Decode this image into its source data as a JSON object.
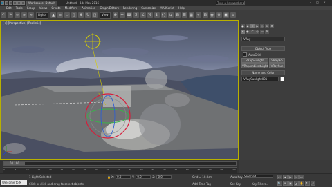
{
  "titlebar": {
    "workspace": "Workspace: Default",
    "file_title": "Untitled - 3ds Max 2016",
    "search_placeholder": "Type a keyword or phrase"
  },
  "menubar": {
    "items": [
      "Edit",
      "Tools",
      "Group",
      "Views",
      "Create",
      "Modifiers",
      "Animation",
      "Graph Editors",
      "Rendering",
      "Customize",
      "MAXScript",
      "Help"
    ]
  },
  "toolbar": {
    "selection_filter": "Lights",
    "reference_coord": "View"
  },
  "viewport": {
    "label": "[+] [Perspective] [Realistic]"
  },
  "command_panel": {
    "category": "VRay",
    "object_type_header": "Object Type",
    "autogrid_label": "AutoGrid",
    "buttons": [
      "VRaySunlight",
      "VRayIES",
      "VRayAmbientLight",
      "VRaySun"
    ],
    "name_color_header": "Name and Color",
    "object_name": "VRaySunlight001",
    "swatch_color": "#ffffff"
  },
  "timeline": {
    "frame_readout": "0 / 100",
    "ticks": [
      "0",
      "5",
      "10",
      "15",
      "20",
      "25",
      "30",
      "35",
      "40",
      "45",
      "50",
      "55",
      "60",
      "65",
      "70",
      "75",
      "80",
      "85",
      "90",
      "95",
      "100"
    ]
  },
  "statusbar": {
    "welcome": "Welcome to M",
    "selection_status": "1 Light Selected",
    "prompt": "Click or click-and-drag to select objects",
    "x_label": "X:",
    "x_value": "0.0",
    "y_label": "Y:",
    "y_value": "0.0",
    "z_label": "Z:",
    "z_value": "0.0",
    "grid": "Grid = 10.0cm",
    "add_time_tag": "Add Time Tag",
    "auto_key": "Auto Key",
    "set_key": "Set Key",
    "selected": "Selected",
    "key_filters": "Key Filters..."
  }
}
